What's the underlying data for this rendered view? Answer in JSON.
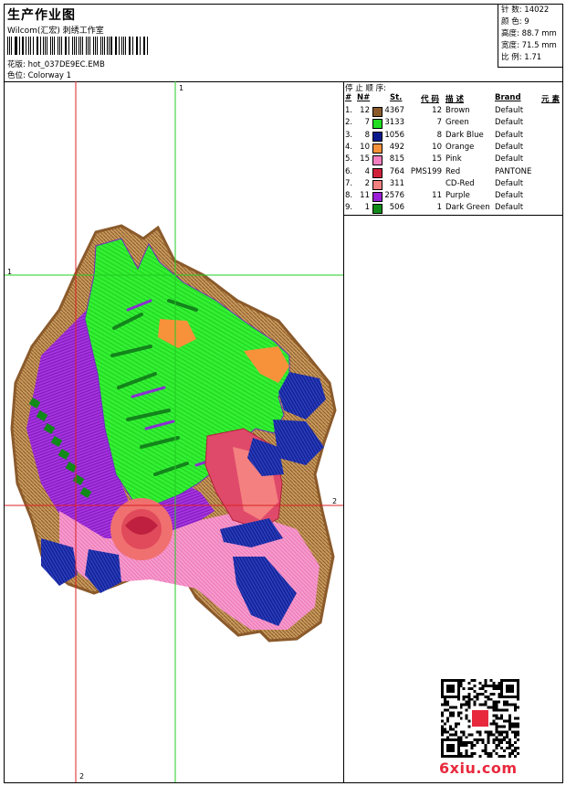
{
  "header": {
    "title": "生产作业图",
    "subtitle": "Wilcom(汇宏) 刺绣工作室",
    "file_line": "花版: hot_037DE9EC.EMB",
    "color_line": "色位: Colorway 1"
  },
  "stats": [
    {
      "label": "针 数:",
      "value": "14022"
    },
    {
      "label": "颜 色:",
      "value": "9"
    },
    {
      "label": "高度:",
      "value": "88.7 mm"
    },
    {
      "label": "宽度:",
      "value": "71.5 mm"
    },
    {
      "label": "比 例:",
      "value": "1.71"
    }
  ],
  "guides": {
    "v1": "1",
    "h1": "1",
    "h2": "2",
    "v2": "2"
  },
  "stop_sequence": {
    "title": "停 止 顺 序:",
    "headers": [
      "#",
      "N#",
      "St.",
      "代 码",
      "描 述",
      "Brand",
      "元 素"
    ],
    "rows": [
      {
        "idx": "1.",
        "n": "12",
        "color": "#8b5a2b",
        "st": "4367",
        "code": "12",
        "desc": "Brown",
        "brand": "Default"
      },
      {
        "idx": "2.",
        "n": "7",
        "color": "#22dd22",
        "st": "3133",
        "code": "7",
        "desc": "Green",
        "brand": "Default"
      },
      {
        "idx": "3.",
        "n": "8",
        "color": "#0a1a8c",
        "st": "1056",
        "code": "8",
        "desc": "Dark Blue",
        "brand": "Default"
      },
      {
        "idx": "4.",
        "n": "10",
        "color": "#f7923a",
        "st": "492",
        "code": "10",
        "desc": "Orange",
        "brand": "Default"
      },
      {
        "idx": "5.",
        "n": "15",
        "color": "#f47fc0",
        "st": "815",
        "code": "15",
        "desc": "Pink",
        "brand": "Default"
      },
      {
        "idx": "6.",
        "n": "4",
        "color": "#d0203a",
        "st": "764",
        "code": "PMS199",
        "desc": "Red",
        "brand": "PANTONE"
      },
      {
        "idx": "7.",
        "n": "2",
        "color": "#f48080",
        "st": "311",
        "code": "",
        "desc": "CD-Red",
        "brand": "Default"
      },
      {
        "idx": "8.",
        "n": "11",
        "color": "#9b1fd6",
        "st": "2576",
        "code": "11",
        "desc": "Purple",
        "brand": "Default"
      },
      {
        "idx": "9.",
        "n": "1",
        "color": "#118a1a",
        "st": "506",
        "code": "1",
        "desc": "Dark Green",
        "brand": "Default"
      }
    ]
  },
  "logo_text": "6xiu.com"
}
